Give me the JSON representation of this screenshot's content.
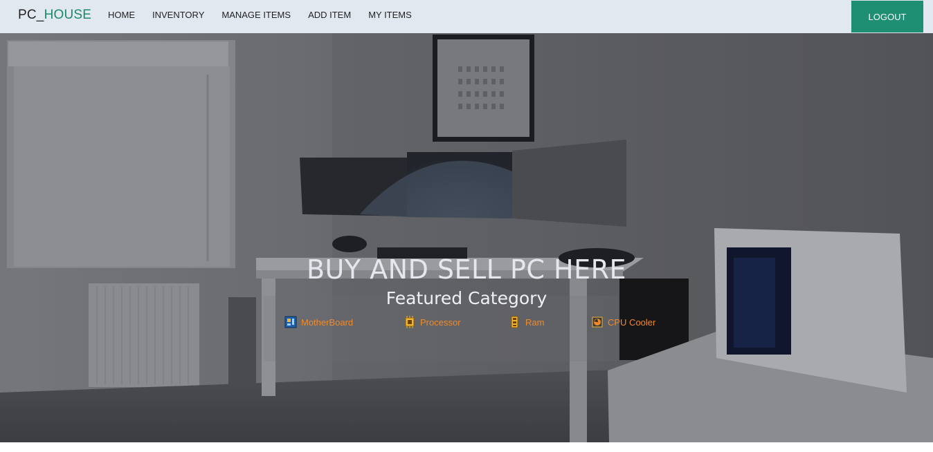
{
  "navbar": {
    "brand_prefix": "PC_",
    "brand_suffix": "HOUSE",
    "links": [
      {
        "label": "HOME"
      },
      {
        "label": "INVENTORY"
      },
      {
        "label": "MANAGE ITEMS"
      },
      {
        "label": "ADD ITEM"
      },
      {
        "label": "MY ITEMS"
      }
    ],
    "logout_label": "LOGOUT"
  },
  "hero": {
    "title": "BUY AND SELL PC HERE",
    "subtitle": "Featured Category",
    "categories": [
      {
        "label": "MotherBoard",
        "icon": "motherboard-icon"
      },
      {
        "label": "Processor",
        "icon": "processor-icon"
      },
      {
        "label": "Ram",
        "icon": "ram-icon"
      },
      {
        "label": "CPU Cooler",
        "icon": "cpu-cooler-icon"
      }
    ]
  },
  "colors": {
    "navbar_bg": "#e1e8ef",
    "brand_accent": "#1a8a6a",
    "logout_bg": "#1e8f73",
    "category_text": "#f08a2a"
  }
}
